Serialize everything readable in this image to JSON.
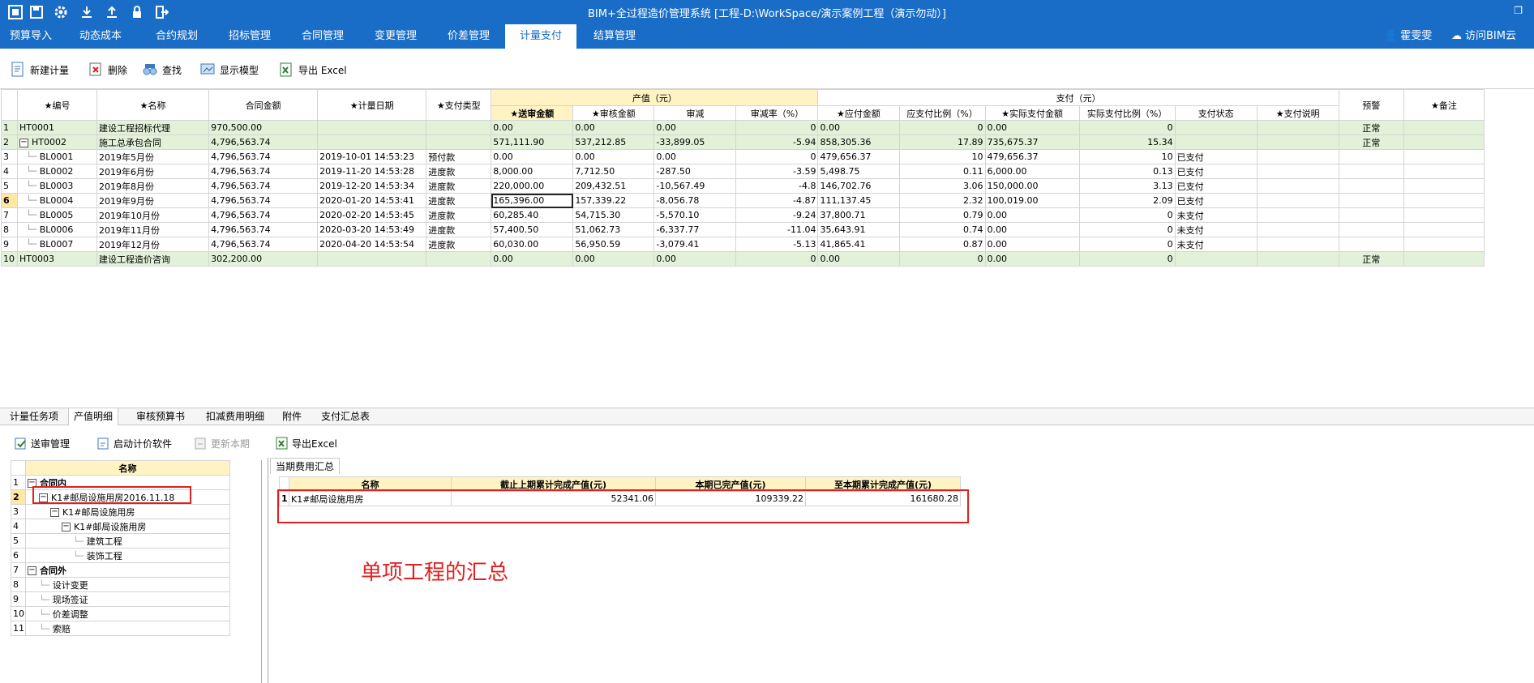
{
  "window": {
    "title": "BIM+全过程造价管理系统 [工程-D:\\WorkSpace/演示案例工程（演示勿动）]",
    "restore_icon": "restore-icon"
  },
  "menu": {
    "tabs": [
      "预算导入",
      "动态成本",
      "合约规划",
      "招标管理",
      "合同管理",
      "变更管理",
      "价差管理",
      "计量支付",
      "结算管理"
    ],
    "active": "计量支付",
    "user": "霍雯雯",
    "cloud": "访问BIM云"
  },
  "toolbar": {
    "new": "新建计量",
    "delete": "删除",
    "find": "查找",
    "show_model": "显示模型",
    "export": "导出 Excel"
  },
  "main_table": {
    "group_output": "产值（元）",
    "group_pay": "支付（元）",
    "headers": [
      "★编号",
      "★名称",
      "合同金额",
      "★计量日期",
      "★支付类型",
      "★送审金额",
      "★审核金额",
      "审减",
      "审减率（%）",
      "★应付金额",
      "应支付比例（%）",
      "★实际支付金额",
      "实际支付比例（%）",
      "支付状态",
      "★支付说明",
      "预警",
      "★备注"
    ],
    "rows": [
      {
        "n": "1",
        "code": "HT0001",
        "name": "建设工程招标代理",
        "amount": "970,500.00",
        "date": "",
        "type": "",
        "sub": "0.00",
        "aud": "0.00",
        "red": "0.00",
        "rate": "0",
        "due": "0.00",
        "dr": "0",
        "paid": "0.00",
        "pr": "0",
        "status": "",
        "note": "",
        "warn": "正常",
        "remark": "",
        "green": true,
        "level": 0,
        "box": ""
      },
      {
        "n": "2",
        "code": "HT0002",
        "name": "施工总承包合同",
        "amount": "4,796,563.74",
        "date": "",
        "type": "",
        "sub": "571,111.90",
        "aud": "537,212.85",
        "red": "-33,899.05",
        "rate": "-5.94",
        "due": "858,305.36",
        "dr": "17.89",
        "paid": "735,675.37",
        "pr": "15.34",
        "status": "",
        "note": "",
        "warn": "正常",
        "remark": "",
        "green": true,
        "level": 0,
        "box": "−"
      },
      {
        "n": "3",
        "code": "BL0001",
        "name": "2019年5月份",
        "amount": "4,796,563.74",
        "date": "2019-10-01 14:53:23",
        "type": "预付款",
        "sub": "0.00",
        "aud": "0.00",
        "red": "0.00",
        "rate": "0",
        "due": "479,656.37",
        "dr": "10",
        "paid": "479,656.37",
        "pr": "10",
        "status": "已支付",
        "note": "",
        "warn": "",
        "remark": "",
        "green": false,
        "level": 1,
        "box": ""
      },
      {
        "n": "4",
        "code": "BL0002",
        "name": "2019年6月份",
        "amount": "4,796,563.74",
        "date": "2019-11-20 14:53:28",
        "type": "进度款",
        "sub": "8,000.00",
        "aud": "7,712.50",
        "red": "-287.50",
        "rate": "-3.59",
        "due": "5,498.75",
        "dr": "0.11",
        "paid": "6,000.00",
        "pr": "0.13",
        "status": "已支付",
        "note": "",
        "warn": "",
        "remark": "",
        "green": false,
        "level": 1,
        "box": ""
      },
      {
        "n": "5",
        "code": "BL0003",
        "name": "2019年8月份",
        "amount": "4,796,563.74",
        "date": "2019-12-20 14:53:34",
        "type": "进度款",
        "sub": "220,000.00",
        "aud": "209,432.51",
        "red": "-10,567.49",
        "rate": "-4.8",
        "due": "146,702.76",
        "dr": "3.06",
        "paid": "150,000.00",
        "pr": "3.13",
        "status": "已支付",
        "note": "",
        "warn": "",
        "remark": "",
        "green": false,
        "level": 1,
        "box": ""
      },
      {
        "n": "6",
        "code": "BL0004",
        "name": "2019年9月份",
        "amount": "4,796,563.74",
        "date": "2020-01-20 14:53:41",
        "type": "进度款",
        "sub": "165,396.00",
        "aud": "157,339.22",
        "red": "-8,056.78",
        "rate": "-4.87",
        "due": "111,137.45",
        "dr": "2.32",
        "paid": "100,019.00",
        "pr": "2.09",
        "status": "已支付",
        "note": "",
        "warn": "",
        "remark": "",
        "green": false,
        "level": 1,
        "box": "",
        "current": true
      },
      {
        "n": "7",
        "code": "BL0005",
        "name": "2019年10月份",
        "amount": "4,796,563.74",
        "date": "2020-02-20 14:53:45",
        "type": "进度款",
        "sub": "60,285.40",
        "aud": "54,715.30",
        "red": "-5,570.10",
        "rate": "-9.24",
        "due": "37,800.71",
        "dr": "0.79",
        "paid": "0.00",
        "pr": "0",
        "status": "未支付",
        "note": "",
        "warn": "",
        "remark": "",
        "green": false,
        "level": 1,
        "box": ""
      },
      {
        "n": "8",
        "code": "BL0006",
        "name": "2019年11月份",
        "amount": "4,796,563.74",
        "date": "2020-03-20 14:53:49",
        "type": "进度款",
        "sub": "57,400.50",
        "aud": "51,062.73",
        "red": "-6,337.77",
        "rate": "-11.04",
        "due": "35,643.91",
        "dr": "0.74",
        "paid": "0.00",
        "pr": "0",
        "status": "未支付",
        "note": "",
        "warn": "",
        "remark": "",
        "green": false,
        "level": 1,
        "box": ""
      },
      {
        "n": "9",
        "code": "BL0007",
        "name": "2019年12月份",
        "amount": "4,796,563.74",
        "date": "2020-04-20 14:53:54",
        "type": "进度款",
        "sub": "60,030.00",
        "aud": "56,950.59",
        "red": "-3,079.41",
        "rate": "-5.13",
        "due": "41,865.41",
        "dr": "0.87",
        "paid": "0.00",
        "pr": "0",
        "status": "未支付",
        "note": "",
        "warn": "",
        "remark": "",
        "green": false,
        "level": 1,
        "box": ""
      },
      {
        "n": "10",
        "code": "HT0003",
        "name": "建设工程造价咨询",
        "amount": "302,200.00",
        "date": "",
        "type": "",
        "sub": "0.00",
        "aud": "0.00",
        "red": "0.00",
        "rate": "0",
        "due": "0.00",
        "dr": "0",
        "paid": "0.00",
        "pr": "0",
        "status": "",
        "note": "",
        "warn": "正常",
        "remark": "",
        "green": true,
        "level": 0,
        "box": ""
      }
    ]
  },
  "bottom_tabs": [
    "计量任务项",
    "产值明细",
    "审核预算书",
    "扣减费用明细",
    "附件",
    "支付汇总表"
  ],
  "bottom_active": "产值明细",
  "sub_toolbar": {
    "review": "送审管理",
    "launch": "启动计价软件",
    "update": "更新本期",
    "export": "导出Excel"
  },
  "tree": {
    "header": "名称",
    "rows": [
      {
        "n": "1",
        "label": "合同内",
        "level": 0,
        "box": "−",
        "bold": true
      },
      {
        "n": "2",
        "label": "K1#邮局设施用房2016.11.18",
        "level": 1,
        "box": "−",
        "bold": false
      },
      {
        "n": "3",
        "label": "K1#邮局设施用房",
        "level": 2,
        "box": "−",
        "bold": false
      },
      {
        "n": "4",
        "label": "K1#邮局设施用房",
        "level": 3,
        "box": "−",
        "bold": false
      },
      {
        "n": "5",
        "label": "建筑工程",
        "level": 4,
        "box": "",
        "bold": false
      },
      {
        "n": "6",
        "label": "装饰工程",
        "level": 4,
        "box": "",
        "bold": false
      },
      {
        "n": "7",
        "label": "合同外",
        "level": 0,
        "box": "−",
        "bold": true
      },
      {
        "n": "8",
        "label": "设计变更",
        "level": 1,
        "box": "",
        "bold": false
      },
      {
        "n": "9",
        "label": "现场签证",
        "level": 1,
        "box": "",
        "bold": false
      },
      {
        "n": "10",
        "label": "价差调整",
        "level": 1,
        "box": "",
        "bold": false
      },
      {
        "n": "11",
        "label": "索赔",
        "level": 1,
        "box": "",
        "bold": false
      }
    ]
  },
  "summary": {
    "tab": "当期费用汇总",
    "headers": [
      "名称",
      "截止上期累计完成产值(元)",
      "本期已完产值(元)",
      "至本期累计完成产值(元)"
    ],
    "rows": [
      {
        "n": "1",
        "name": "K1#邮局设施用房",
        "prev": "52341.06",
        "cur": "109339.22",
        "total": "161680.28"
      }
    ]
  },
  "annotation": "单项工程的汇总",
  "colors": {
    "accent": "#1a6dc7",
    "annotation": "#e02020",
    "row_green": "#e3f1d9",
    "header_yellow": "#fff3c4"
  }
}
